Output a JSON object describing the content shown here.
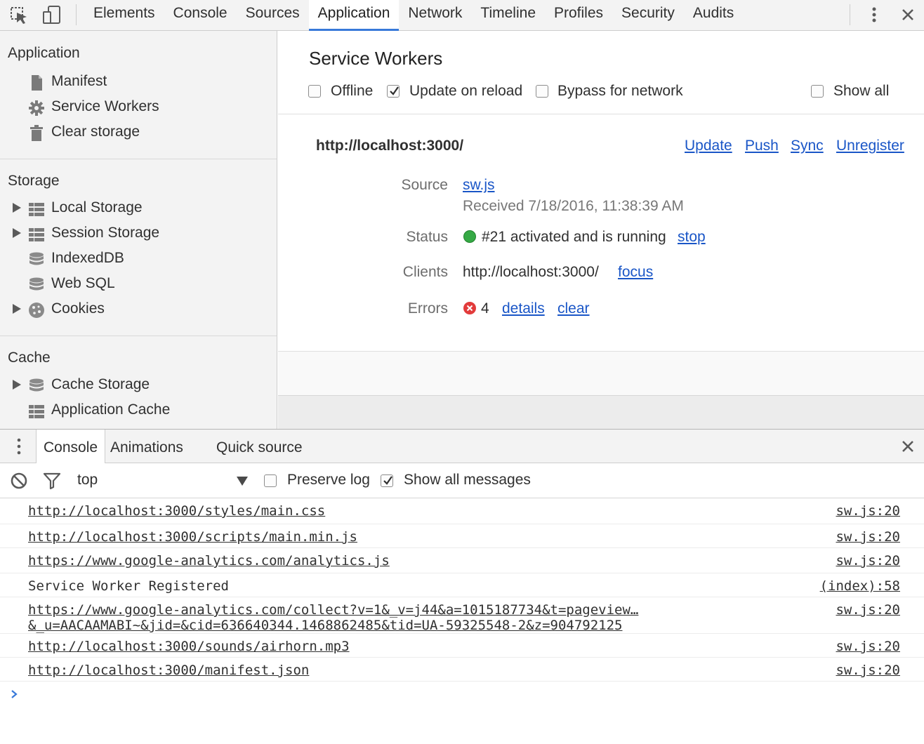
{
  "toolbar": {
    "tabs": [
      "Elements",
      "Console",
      "Sources",
      "Application",
      "Network",
      "Timeline",
      "Profiles",
      "Security",
      "Audits"
    ],
    "active_tab": "Application",
    "icons": [
      "inspect-element-icon",
      "device-mode-icon",
      "more-options-icon",
      "close-icon"
    ]
  },
  "sidebar": {
    "application": {
      "title": "Application",
      "items": [
        {
          "label": "Manifest",
          "icon": "document-icon"
        },
        {
          "label": "Service Workers",
          "icon": "gear-icon"
        },
        {
          "label": "Clear storage",
          "icon": "trash-icon"
        }
      ]
    },
    "storage": {
      "title": "Storage",
      "items": [
        {
          "label": "Local Storage",
          "icon": "grid-icon",
          "expandable": true
        },
        {
          "label": "Session Storage",
          "icon": "grid-icon",
          "expandable": true
        },
        {
          "label": "IndexedDB",
          "icon": "database-icon",
          "expandable": false
        },
        {
          "label": "Web SQL",
          "icon": "database-icon",
          "expandable": false
        },
        {
          "label": "Cookies",
          "icon": "cookie-icon",
          "expandable": true
        }
      ]
    },
    "cache": {
      "title": "Cache",
      "items": [
        {
          "label": "Cache Storage",
          "icon": "database-icon",
          "expandable": true
        },
        {
          "label": "Application Cache",
          "icon": "grid-icon",
          "expandable": false
        }
      ]
    }
  },
  "main": {
    "title": "Service Workers",
    "options": {
      "offline": {
        "label": "Offline",
        "checked": false
      },
      "update_on_reload": {
        "label": "Update on reload",
        "checked": true
      },
      "bypass_for_network": {
        "label": "Bypass for network",
        "checked": false
      },
      "show_all": {
        "label": "Show all",
        "checked": false
      }
    },
    "worker": {
      "origin": "http://localhost:3000/",
      "actions": [
        "Update",
        "Push",
        "Sync",
        "Unregister"
      ],
      "source_label": "Source",
      "source_file": "sw.js",
      "received": "Received 7/18/2016, 11:38:39 AM",
      "status_label": "Status",
      "status_text": "#21 activated and is running",
      "status_action": "stop",
      "clients_label": "Clients",
      "client_url": "http://localhost:3000/",
      "client_action": "focus",
      "errors_label": "Errors",
      "error_count": "4",
      "error_actions": [
        "details",
        "clear"
      ]
    }
  },
  "drawer": {
    "tabs": [
      "Console",
      "Animations",
      "Quick source"
    ],
    "active_tab": "Console",
    "context": "top",
    "preserve_log": {
      "label": "Preserve log",
      "checked": false
    },
    "show_all_messages": {
      "label": "Show all messages",
      "checked": true
    }
  },
  "console": {
    "messages": [
      {
        "text": "http://localhost:3000/styles/main.css",
        "source": "sw.js:20",
        "link": true
      },
      {
        "text": "http://localhost:3000/scripts/main.min.js",
        "source": "sw.js:20",
        "link": true
      },
      {
        "text": "https://www.google-analytics.com/analytics.js",
        "source": "sw.js:20",
        "link": true
      },
      {
        "text": "Service Worker Registered",
        "source": "(index):58",
        "link": false
      },
      {
        "text": "https://www.google-analytics.com/collect?v=1&_v=j44&a=1015187734&t=pageview…",
        "text2": "&_u=AACAAMABI~&jid=&cid=636640344.1468862485&tid=UA-59325548-2&z=904792125",
        "source": "sw.js:20",
        "link": true
      },
      {
        "text": "http://localhost:3000/sounds/airhorn.mp3",
        "source": "sw.js:20",
        "link": true
      },
      {
        "text": "http://localhost:3000/manifest.json",
        "source": "sw.js:20",
        "link": true
      }
    ]
  },
  "colors": {
    "accent": "#3879d9",
    "link": "#1a56c7",
    "status_running": "#35a945",
    "error": "#e23b3b"
  }
}
